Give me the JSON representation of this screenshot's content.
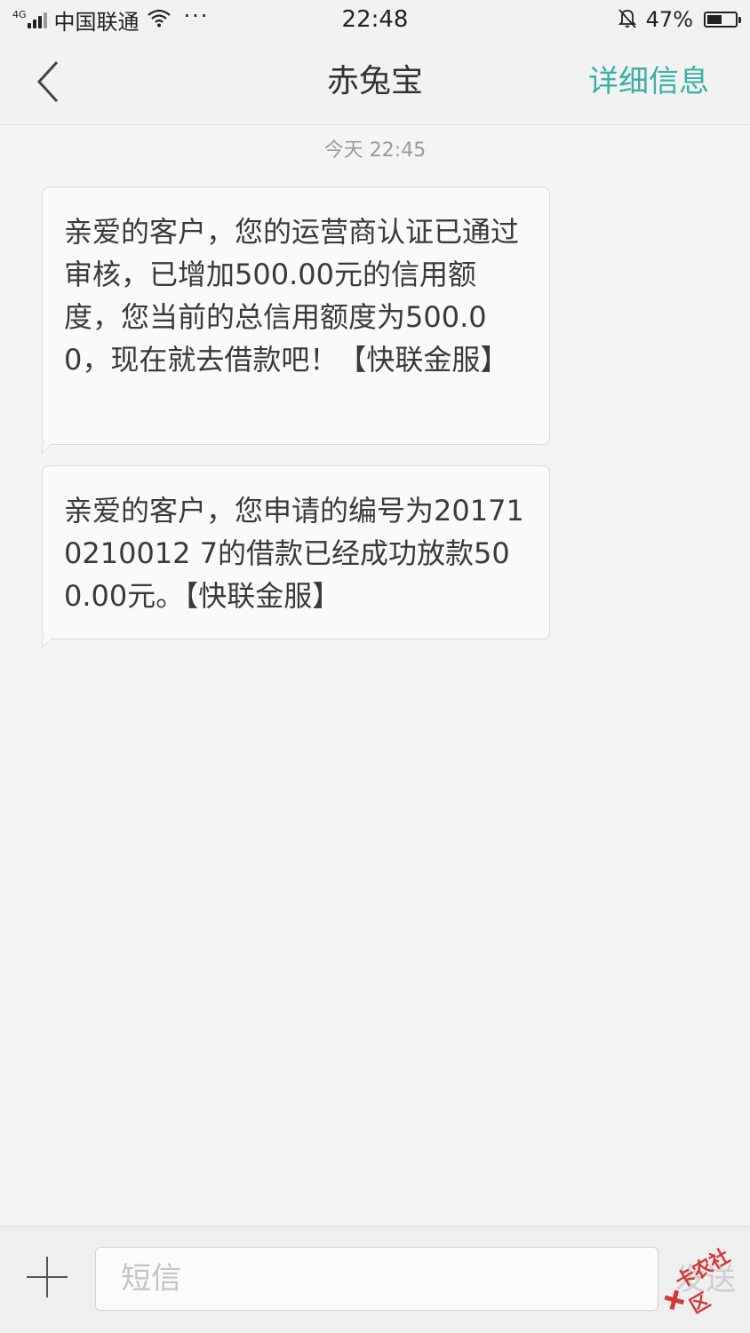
{
  "status_bar": {
    "network": "4G",
    "carrier": "中国联通",
    "more": "···",
    "time": "22:48",
    "battery": "47%",
    "battery_level": 0.47
  },
  "header": {
    "title": "赤兔宝",
    "detail_label": "详细信息",
    "accent_color": "#3ab1a3"
  },
  "conversation": {
    "timestamp": "今天  22:45",
    "messages": [
      {
        "text": "亲爱的客户，您的运营商认证已通过审核，已增加500.00元的信用额度，您当前的总信用额度为500.00，现在就去借款吧！【快联金服】"
      },
      {
        "text": "亲爱的客户，您申请的编号为201710210012 7的借款已经成功放款500.00元。【快联金服】"
      }
    ]
  },
  "composer": {
    "placeholder": "短信",
    "send_label": "发送"
  },
  "watermark": {
    "text": "卡农社区"
  }
}
